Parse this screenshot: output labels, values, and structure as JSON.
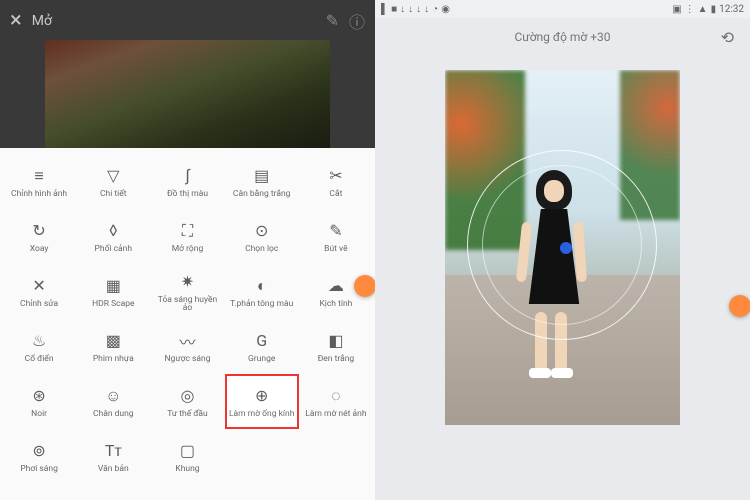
{
  "left": {
    "topbar": {
      "title": "Mở"
    },
    "tools": [
      {
        "id": "tune",
        "label": "Chỉnh hình ảnh"
      },
      {
        "id": "details",
        "label": "Chi tiết"
      },
      {
        "id": "curves",
        "label": "Đồ thị màu"
      },
      {
        "id": "whitebalance",
        "label": "Cân bằng trắng"
      },
      {
        "id": "crop",
        "label": "Cắt"
      },
      {
        "id": "rotate",
        "label": "Xoay"
      },
      {
        "id": "perspective",
        "label": "Phối cảnh"
      },
      {
        "id": "expand",
        "label": "Mở rộng"
      },
      {
        "id": "selective",
        "label": "Chọn lọc"
      },
      {
        "id": "brush",
        "label": "Bút vẽ"
      },
      {
        "id": "healing",
        "label": "Chỉnh sửa"
      },
      {
        "id": "hdr",
        "label": "HDR Scape"
      },
      {
        "id": "glamour",
        "label": "Tỏa sáng huyền ảo"
      },
      {
        "id": "tonal",
        "label": "T.phản tông màu"
      },
      {
        "id": "drama",
        "label": "Kịch tính"
      },
      {
        "id": "vintage",
        "label": "Cổ điển"
      },
      {
        "id": "grainy",
        "label": "Phim nhựa"
      },
      {
        "id": "retrolux",
        "label": "Ngược sáng"
      },
      {
        "id": "grunge",
        "label": "Grunge"
      },
      {
        "id": "bw",
        "label": "Đen trắng"
      },
      {
        "id": "noir",
        "label": "Noir"
      },
      {
        "id": "portrait",
        "label": "Chân dung"
      },
      {
        "id": "headpose",
        "label": "Tư thế đầu"
      },
      {
        "id": "lensblur",
        "label": "Làm mờ ống kính"
      },
      {
        "id": "vignette",
        "label": "Làm mờ nét ảnh"
      },
      {
        "id": "glow",
        "label": "Phơi sáng"
      },
      {
        "id": "text",
        "label": "Văn bản"
      },
      {
        "id": "frames",
        "label": "Khung"
      }
    ],
    "highlight_index": 23
  },
  "right": {
    "status": {
      "time": "12:32"
    },
    "slider_label": "Cường độ mờ +30"
  },
  "icons": {
    "tune": "≡",
    "details": "▽",
    "curves": "∫",
    "whitebalance": "▤",
    "crop": "✂",
    "rotate": "↻",
    "perspective": "◊",
    "expand": "⛶",
    "selective": "⊙",
    "brush": "✎",
    "healing": "✕",
    "hdr": "▦",
    "glamour": "✷",
    "tonal": "◐",
    "drama": "☁",
    "vintage": "♨",
    "grainy": "▩",
    "retrolux": "〰",
    "grunge": "G",
    "bw": "◧",
    "noir": "⊛",
    "portrait": "☺",
    "headpose": "◎",
    "lensblur": "⊕",
    "vignette": "◌",
    "glow": "⊚",
    "text": "Tᴛ",
    "frames": "▢"
  }
}
